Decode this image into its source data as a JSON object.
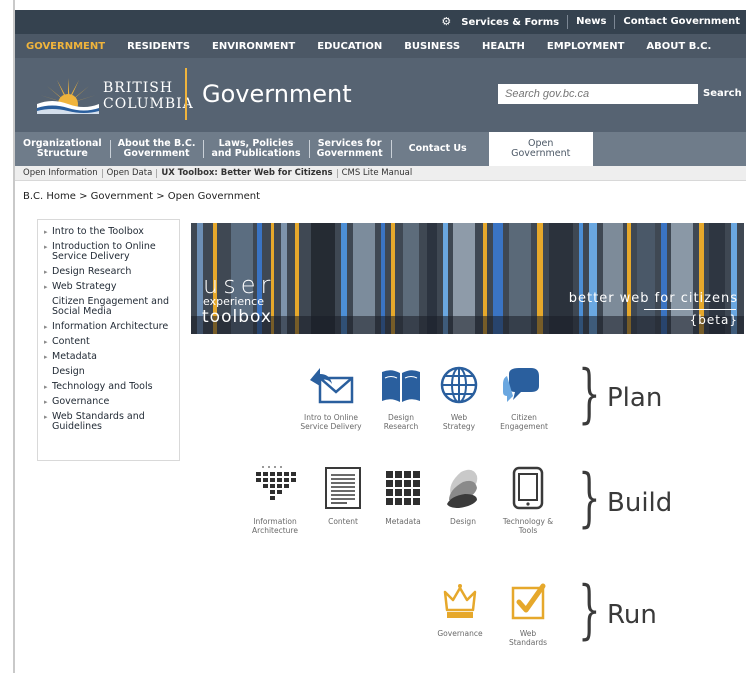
{
  "utility": {
    "services_forms": "Services & Forms",
    "news": "News",
    "contact_government": "Contact Government"
  },
  "mainnav": [
    "GOVERNMENT",
    "RESIDENTS",
    "ENVIRONMENT",
    "EDUCATION",
    "BUSINESS",
    "HEALTH",
    "EMPLOYMENT",
    "ABOUT B.C."
  ],
  "header": {
    "logo_line1": "BRITISH",
    "logo_line2": "COLUMBIA",
    "title": "Government",
    "search_placeholder": "Search gov.bc.ca",
    "search_button": "Search"
  },
  "subnav": [
    {
      "l1": "Organizational",
      "l2": "Structure"
    },
    {
      "l1": "About the B.C.",
      "l2": "Government"
    },
    {
      "l1": "Laws, Policies",
      "l2": "and Publications"
    },
    {
      "l1": "Services for",
      "l2": "Government"
    },
    {
      "l1": "Contact Us",
      "l2": ""
    },
    {
      "l1": "Open",
      "l2": "Government"
    }
  ],
  "tertiary": [
    "Open Information",
    "Open Data",
    "UX Toolbox: Better Web for Citizens",
    "CMS Lite Manual"
  ],
  "breadcrumb": "B.C. Home > Government > Open Government",
  "sidebar": [
    {
      "label": "Intro to the Toolbox",
      "arrow": true
    },
    {
      "label": "Introduction to Online Service Delivery",
      "arrow": true
    },
    {
      "label": "Design Research",
      "arrow": true
    },
    {
      "label": "Web Strategy",
      "arrow": true
    },
    {
      "label": "Citizen Engagement and Social Media",
      "arrow": false
    },
    {
      "label": "Information Architecture",
      "arrow": true
    },
    {
      "label": "Content",
      "arrow": true
    },
    {
      "label": "Metadata",
      "arrow": true
    },
    {
      "label": "Design",
      "arrow": false
    },
    {
      "label": "Technology and Tools",
      "arrow": true
    },
    {
      "label": "Governance",
      "arrow": true
    },
    {
      "label": "Web Standards and Guidelines",
      "arrow": true
    }
  ],
  "banner": {
    "user": "user",
    "experience": "experience",
    "toolbox": "toolbox",
    "tagline": "better web for citizens",
    "beta": "{beta}"
  },
  "plan": {
    "stage": "Plan",
    "tiles": [
      {
        "label1": "Intro to Online",
        "label2": "Service Delivery",
        "icon": "envelope-arrow-icon"
      },
      {
        "label1": "Design",
        "label2": "Research",
        "icon": "book-icon"
      },
      {
        "label1": "Web",
        "label2": "Strategy",
        "icon": "globe-icon"
      },
      {
        "label1": "Citizen",
        "label2": "Engagement",
        "icon": "speech-bubbles-icon"
      }
    ]
  },
  "build": {
    "stage": "Build",
    "tiles": [
      {
        "label1": "Information",
        "label2": "Architecture",
        "icon": "sitemap-icon"
      },
      {
        "label1": "Content",
        "label2": "",
        "icon": "document-icon"
      },
      {
        "label1": "Metadata",
        "label2": "",
        "icon": "grid-icon"
      },
      {
        "label1": "Design",
        "label2": "",
        "icon": "layers-icon"
      },
      {
        "label1": "Technology &",
        "label2": "Tools",
        "icon": "tablet-icon"
      }
    ]
  },
  "run": {
    "stage": "Run",
    "tiles": [
      {
        "label1": "Governance",
        "label2": "",
        "icon": "crown-icon"
      },
      {
        "label1": "Web",
        "label2": "Standards",
        "icon": "checkbox-icon"
      }
    ]
  },
  "colors": {
    "accent": "#f0b43c",
    "nav_dark": "#35424f",
    "icon_blue": "#2a5f9e"
  }
}
